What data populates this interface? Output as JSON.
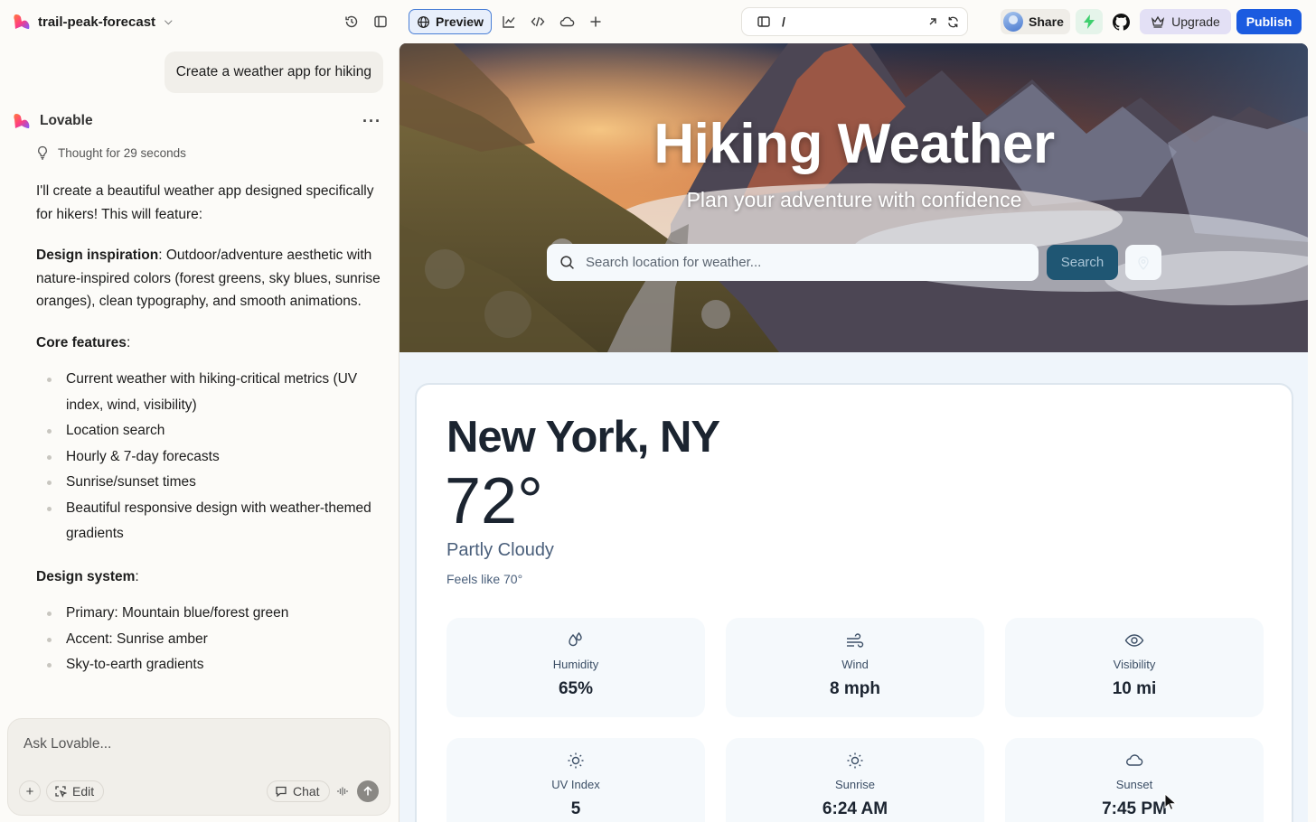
{
  "project": {
    "name": "trail-peak-forecast"
  },
  "toolbar": {
    "preview_label": "Preview",
    "url_path": "/",
    "share_label": "Share",
    "upgrade_label": "Upgrade",
    "publish_label": "Publish"
  },
  "chat": {
    "user_message": "Create a weather app for hiking",
    "assistant_name": "Lovable",
    "thought": "Thought for 29 seconds",
    "intro": "I'll create a beautiful weather app designed specifically for hikers! This will feature:",
    "design_inspiration_title": "Design inspiration",
    "design_inspiration_text": ": Outdoor/adventure aesthetic with nature-inspired colors (forest greens, sky blues, sunrise oranges), clean typography, and smooth animations.",
    "core_features_title": "Core features",
    "core_features_colon": ":",
    "core_features": [
      "Current weather with hiking-critical metrics (UV index, wind, visibility)",
      "Location search",
      "Hourly & 7-day forecasts",
      "Sunrise/sunset times",
      "Beautiful responsive design with weather-themed gradients"
    ],
    "design_system_title": "Design system",
    "design_system_colon": ":",
    "design_system": [
      "Primary: Mountain blue/forest green",
      "Accent: Sunrise amber",
      "Sky-to-earth gradients"
    ],
    "composer_placeholder": "Ask Lovable...",
    "edit_label": "Edit",
    "chat_label": "Chat"
  },
  "app": {
    "hero_title": "Hiking Weather",
    "hero_subtitle": "Plan your adventure with confidence",
    "search_placeholder": "Search location for weather...",
    "search_button": "Search",
    "city": "New York, NY",
    "temperature": "72°",
    "condition": "Partly Cloudy",
    "feels_like": "Feels like 70°",
    "stats": [
      {
        "icon": "humidity-icon",
        "label": "Humidity",
        "value": "65%"
      },
      {
        "icon": "wind-icon",
        "label": "Wind",
        "value": "8 mph"
      },
      {
        "icon": "eye-icon",
        "label": "Visibility",
        "value": "10 mi"
      },
      {
        "icon": "sun-icon",
        "label": "UV Index",
        "value": "5"
      },
      {
        "icon": "sun-icon",
        "label": "Sunrise",
        "value": "6:24 AM"
      },
      {
        "icon": "cloud-icon",
        "label": "Sunset",
        "value": "7:45 PM"
      }
    ]
  },
  "colors": {
    "publish": "#1b5be0",
    "upgrade": "#e3e0f5",
    "search_button": "#1f5673",
    "preview_bg": "#eff5fb"
  }
}
